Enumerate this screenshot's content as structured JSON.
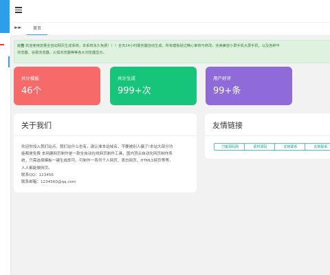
{
  "tabs": {
    "home_label": "首页"
  },
  "notice": {
    "prefix": "公告",
    "line1": "欢迎使用流量全自动网页生成系统，本系统永久免费！！！全天24小时服务器自动生成，所有模板经过精心审核与修改，完美兼容小屏手机大屏手机，以及各种平",
    "line2": "浏览器、谷歌浏览器、火狐浏览器等等各大浏览器显示。"
  },
  "stats": [
    {
      "label": "共计模板",
      "value": "46个",
      "color": "#f76a6a"
    },
    {
      "label": "共计生成",
      "value": "999+次",
      "color": "#16c47a"
    },
    {
      "label": "用户好评",
      "value": "99+条",
      "color": "#8e6bd9"
    }
  ],
  "about": {
    "title": "关于我们",
    "lines": [
      "欢迎你加入我们站点，我们站什么也有，谢认准本站域名，不要被别人骗了!本站大部分功",
      "能都是免费 本网建网页制作是一款全自动在线网页制作工具，国内顶尖自动化网页制作系",
      "统，只需选择模板一键生成即可。可制作一系列个人网页、表白网页、HTML5网页等等，",
      "人人都能做网页。",
      "联系QQ：123456",
      "联系邮箱：1234560@qq.com"
    ]
  },
  "links": {
    "title": "友情链接",
    "items": [
      "刀客源码网",
      "素材源码",
      "友链联系",
      "友链联系"
    ]
  }
}
